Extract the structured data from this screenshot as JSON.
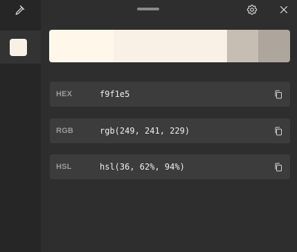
{
  "current_color_hex": "#f9f1e5",
  "sidebar": {
    "picker_icon": "eyedropper-icon",
    "history": [
      {
        "swatch_color": "#f9f1e5"
      }
    ]
  },
  "titlebar": {
    "handle_icon": "drag-handle-icon",
    "settings_icon": "gear-icon",
    "close_icon": "close-icon"
  },
  "shades": [
    "#fff8ea",
    "#f9f1e5",
    "#f3ebdf",
    "#c6beb3",
    "#aea59d"
  ],
  "formats": [
    {
      "label": "HEX",
      "value": "f9f1e5",
      "copy_icon": "copy-icon"
    },
    {
      "label": "RGB",
      "value": "rgb(249, 241, 229)",
      "copy_icon": "copy-icon"
    },
    {
      "label": "HSL",
      "value": "hsl(36, 62%, 94%)",
      "copy_icon": "copy-icon"
    }
  ]
}
